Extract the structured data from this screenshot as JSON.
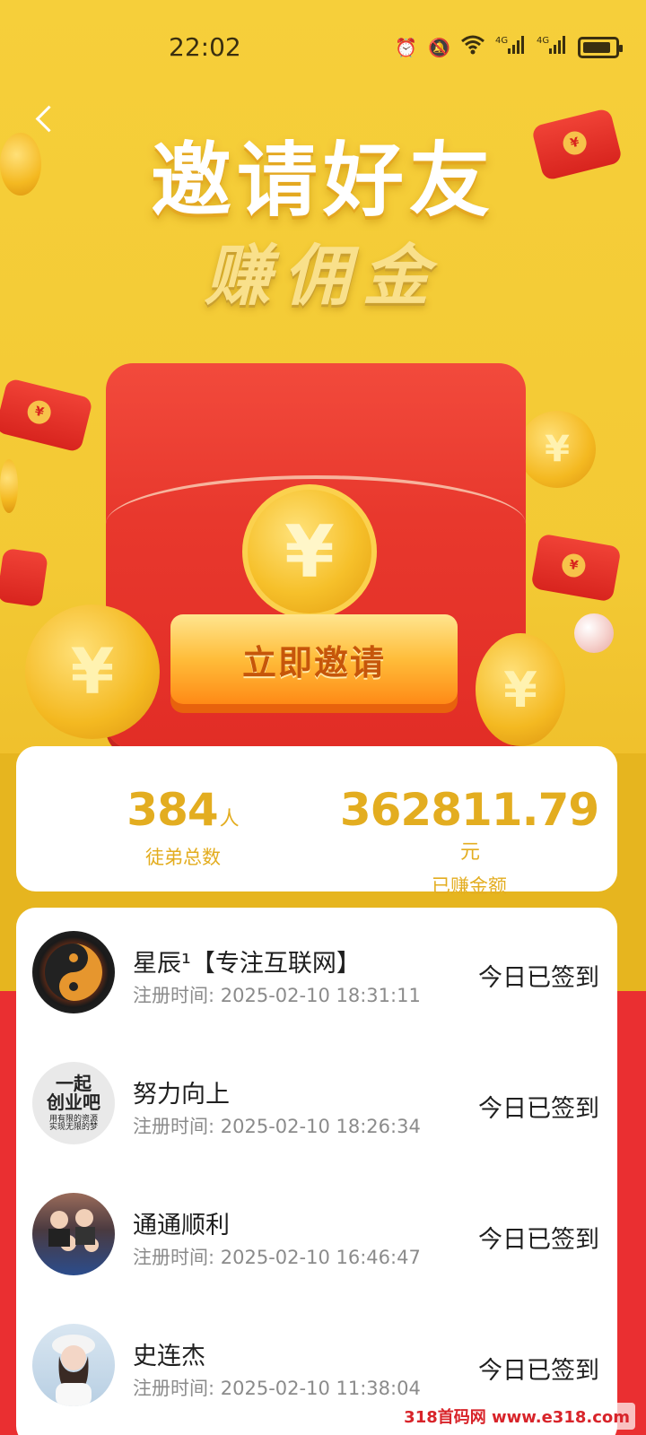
{
  "status_bar": {
    "time": "22:02",
    "icons": [
      "alarm-icon",
      "mute-icon",
      "wifi-icon",
      "signal-4g-icon",
      "signal-4g-icon",
      "battery-charging-icon"
    ],
    "network_labels": [
      "4G",
      "4G"
    ]
  },
  "hero": {
    "title": "邀请好友",
    "subtitle": "赚佣金",
    "coin_symbol": "¥",
    "invite_button": "立即邀请"
  },
  "stats": {
    "disciples_value": "384",
    "disciples_unit": "人",
    "disciples_label": "徒弟总数",
    "earned_value": "362811.79",
    "earned_unit": "元",
    "earned_label": "已赚金额"
  },
  "members": [
    {
      "name": "星辰¹【专注互联网】",
      "reg_label": "注册时间:",
      "reg_time": "2025-02-10 18:31:11",
      "status": "今日已签到",
      "avatar": "yin-yang-avatar"
    },
    {
      "name": "努力向上",
      "reg_label": "注册时间:",
      "reg_time": "2025-02-10 18:26:34",
      "status": "今日已签到",
      "avatar": "text-avatar",
      "avatar_text_1": "一起",
      "avatar_text_2": "创业吧",
      "avatar_text_3": "用有限的资源",
      "avatar_text_4": "实现无限的梦"
    },
    {
      "name": "通通顺利",
      "reg_label": "注册时间:",
      "reg_time": "2025-02-10 16:46:47",
      "status": "今日已签到",
      "avatar": "group-photo-avatar"
    },
    {
      "name": "史连杰",
      "reg_label": "注册时间:",
      "reg_time": "2025-02-10 11:38:04",
      "status": "今日已签到",
      "avatar": "portrait-avatar"
    }
  ],
  "watermark": "318首码网 www.e318.com",
  "colors": {
    "accent_gold": "#e3ad20",
    "brand_red": "#ea2f31",
    "hero_yellow": "#f3c934"
  }
}
